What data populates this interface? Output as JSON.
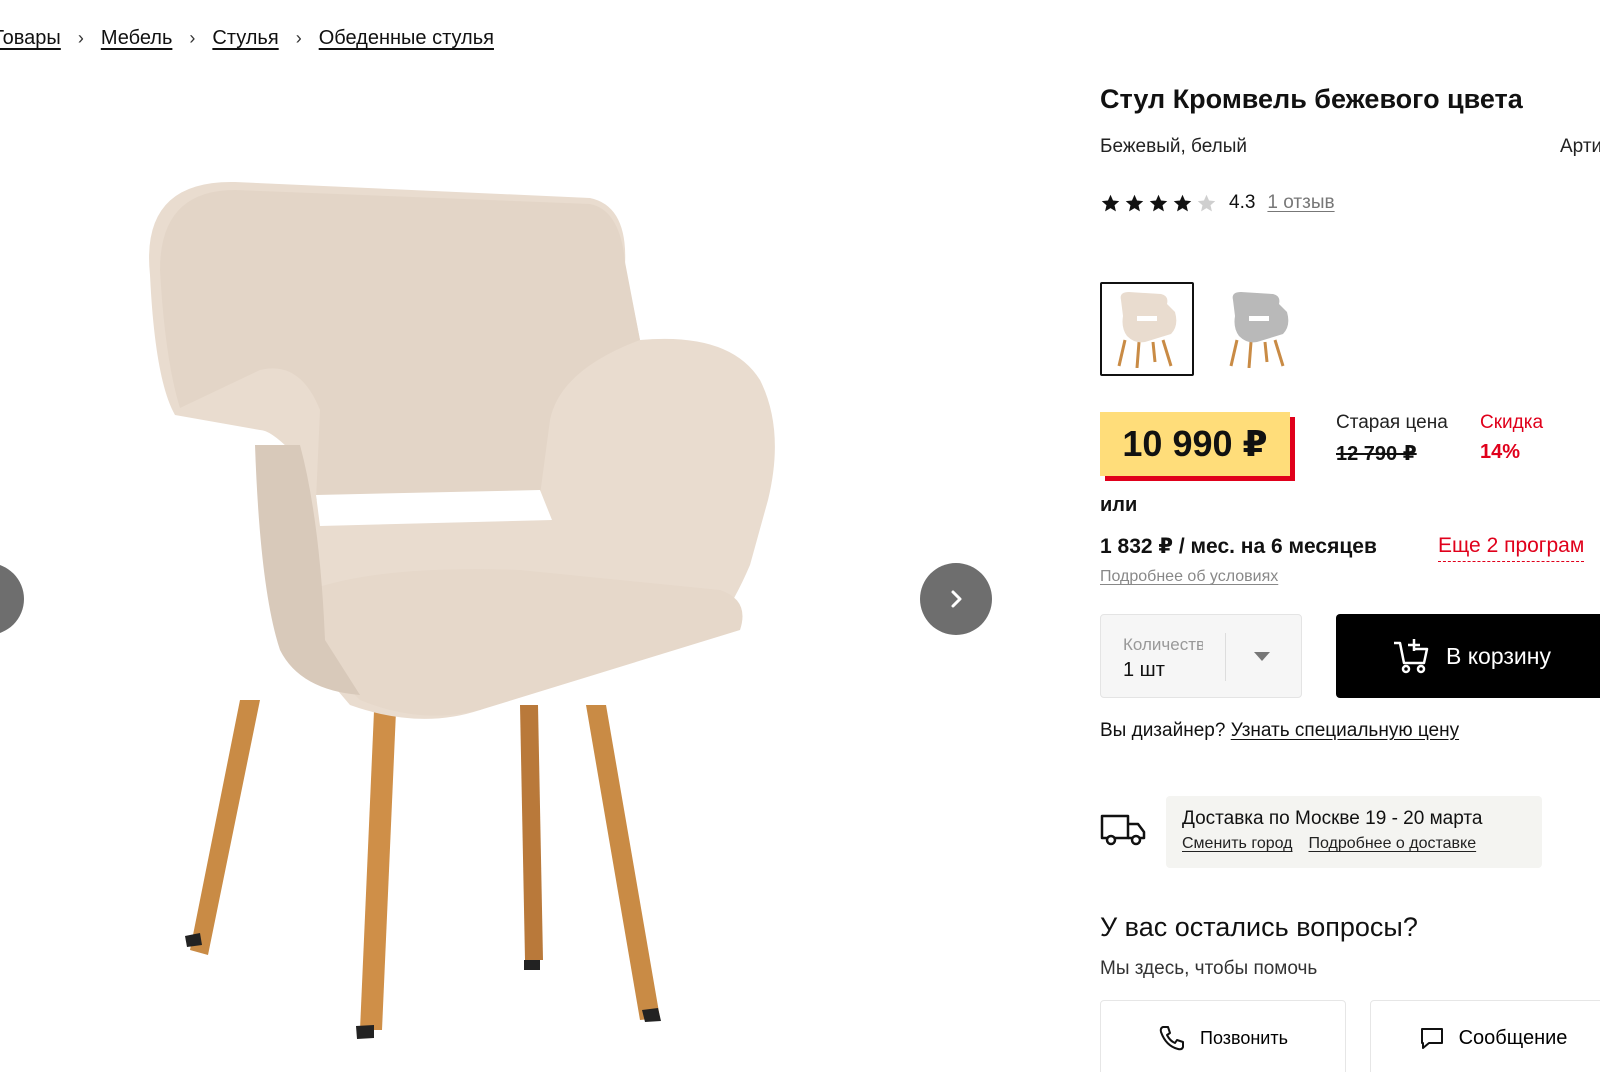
{
  "breadcrumb": [
    "Товары",
    "Мебель",
    "Стулья",
    "Обеденные стулья"
  ],
  "product": {
    "title": "Стул Кромвель бежевого цвета",
    "colors": "Бежевый, белый",
    "article_prefix": "Арти",
    "rating": "4.3",
    "rating_stars": 4,
    "reviews": "1 отзыв"
  },
  "variants": [
    {
      "name": "beige",
      "color": "#e9dccf",
      "active": true
    },
    {
      "name": "grey",
      "color": "#b9b9b9",
      "active": false
    }
  ],
  "price": {
    "current": "10 990 ₽",
    "old_label": "Старая цена",
    "old": "12 790 ₽",
    "discount_label": "Скидка",
    "discount": "14%"
  },
  "installment": {
    "or": "или",
    "text": "1 832 ₽ / мес. на 6 месяцев",
    "more": "Еще 2 програм",
    "conditions": "Подробнее об условиях"
  },
  "quantity": {
    "label": "Количество",
    "value": "1 шт"
  },
  "cart": {
    "label": "В корзину"
  },
  "designer": {
    "text": "Вы дизайнер?",
    "link": "Узнать специальную цену"
  },
  "delivery": {
    "title": "Доставка по Москве 19 - 20 марта",
    "change_city": "Сменить город",
    "details": "Подробнее о доставке"
  },
  "help": {
    "title": "У вас остались вопросы?",
    "subtitle": "Мы здесь, чтобы помочь",
    "call": "Позвонить",
    "message": "Сообщение"
  },
  "colors": {
    "accent": "#e0001b",
    "price_bg": "#ffdd7a",
    "chair_fabric": "#e9dccf",
    "chair_legs": "#c98b45"
  }
}
